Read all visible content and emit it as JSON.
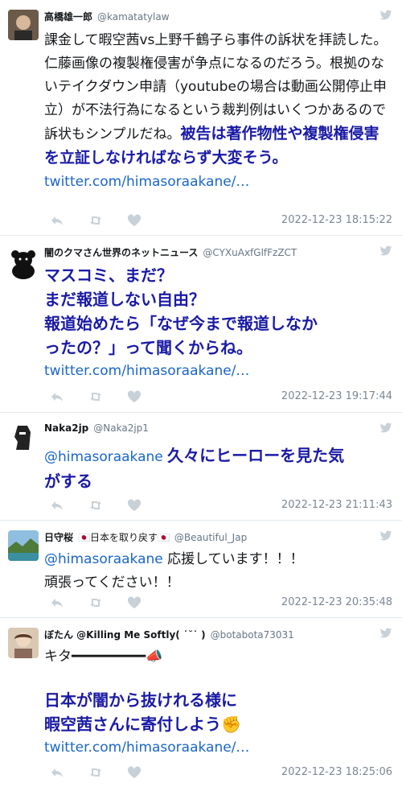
{
  "tweets": [
    {
      "name": "高橋雄一郎",
      "handle": "@kamatatylaw",
      "text_plain": "課金して暇空茜vs上野千鶴子ら事件の訴状を拝読した。仁藤画像の複製権侵害が争点になるのだろう。根拠のないテイクダウン申請（youtubeの場合は動画公開停止申立）が不法行為になるという裁判例はいくつかあるので訴状もシンプルだね。",
      "text_bold": "被告は著作物性や複製権侵害を立証しなければならず大変そう。",
      "link": "twitter.com/himasoraakane/…",
      "timestamp": "2022-12-23 18:15:22"
    },
    {
      "name": "闇のクマさん世界のネットニュース",
      "handle": "@CYXuAxfGlfFzZCT",
      "text_bold": "マスコミ、まだ？ まだ報道しない自由？ 報道始めたら「なぜ今まで報道しなかったの？」って聞くからね。",
      "lines": [
        "マスコミ、まだ？",
        "まだ報道しない自由？",
        "報道始めたら「なぜ今まで報道しなか",
        "ったの？」って聞くからね。"
      ],
      "link": "twitter.com/himasoraakane/…",
      "timestamp": "2022-12-23 19:17:44"
    },
    {
      "name": "Naka2jp",
      "handle": "@Naka2jp1",
      "mention": "@himasoraakane",
      "text_bold": "久々にヒーローを見た気がする",
      "line1": "久々にヒーローを見た気",
      "line2": "がする",
      "timestamp": "2022-12-23 21:11:43"
    },
    {
      "name": "日守桜",
      "name_badge": "🇯🇵日本を取り戻す🇯🇵",
      "handle": "@Beautiful_Jap",
      "mention": "@himasoraakane",
      "text_plain": "応援しています！！！",
      "text_plain2": "頑張ってください！！",
      "timestamp": "2022-12-23 20:35:48"
    },
    {
      "name": "ぼたん @Killing Me Softly( ˙˘˙ )",
      "handle": "@botabota73031",
      "text_plain": "キタ━━━━━━━━━📣",
      "text_bold": "日本が闇から抜けれる様に暇空茜さんに寄付しよう✊",
      "line1": "日本が闇から抜けれる様に",
      "line2": "暇空茜さんに寄付しよう✊",
      "link": "twitter.com/himasoraakane/…",
      "timestamp": "2022-12-23 18:25:06"
    }
  ],
  "colors": {
    "link": "#1a66c8",
    "bold_text": "#1a1aa6",
    "meta": "#7b8794",
    "divider": "#e1e8ed"
  },
  "icons": [
    "reply-icon",
    "retweet-icon",
    "like-icon",
    "twitter-bird-icon"
  ]
}
